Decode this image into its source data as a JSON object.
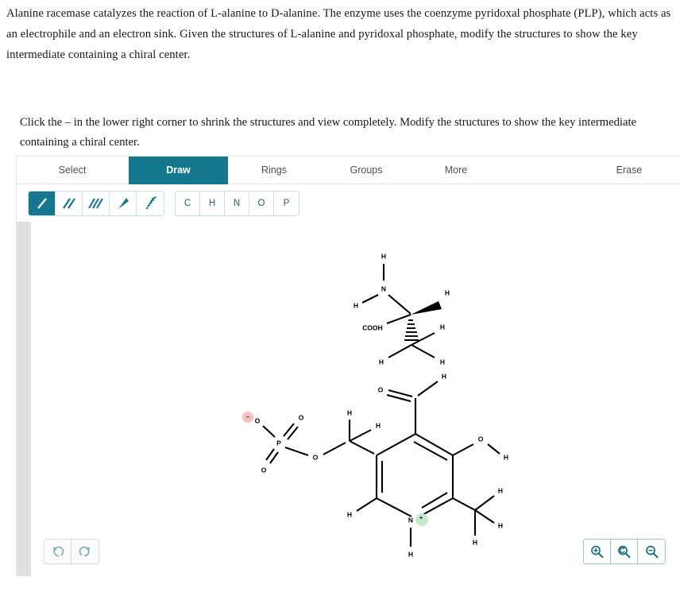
{
  "question": {
    "text": "Alanine racemase catalyzes the reaction of L-alanine to D-alanine. The enzyme uses the coenzyme pyridoxal phosphate (PLP), which acts as an electrophile and an electron sink. Given the structures of L-alanine and pyridoxal phosphate, modify the structures to show the key intermediate containing a chiral center."
  },
  "instruction": {
    "text": "Click the – in the lower right corner to shrink the structures and view completely. Modify the structures to show the key intermediate containing a chiral center."
  },
  "editor": {
    "tabs": [
      {
        "label": "Select",
        "active": false
      },
      {
        "label": "Draw",
        "active": true
      },
      {
        "label": "Rings",
        "active": false
      },
      {
        "label": "Groups",
        "active": false
      },
      {
        "label": "More",
        "active": false
      },
      {
        "label": "Erase",
        "active": false
      }
    ],
    "bond_tools": [
      {
        "name": "single-bond-tool",
        "icon": "single-bond-icon",
        "active": true
      },
      {
        "name": "double-bond-tool",
        "icon": "double-bond-icon",
        "active": false
      },
      {
        "name": "triple-bond-tool",
        "icon": "triple-bond-icon",
        "active": false
      },
      {
        "name": "wedge-bond-tool",
        "icon": "wedge-bond-icon",
        "active": false
      },
      {
        "name": "hash-bond-tool",
        "icon": "hash-bond-icon",
        "active": false
      }
    ],
    "element_tools": [
      {
        "label": "C",
        "name": "element-carbon"
      },
      {
        "label": "H",
        "name": "element-hydrogen"
      },
      {
        "label": "N",
        "name": "element-nitrogen"
      },
      {
        "label": "O",
        "name": "element-oxygen"
      },
      {
        "label": "P",
        "name": "element-phosphorus"
      }
    ],
    "history_tools": [
      {
        "name": "undo-button",
        "icon": "undo-arrow-icon"
      },
      {
        "name": "redo-button",
        "icon": "redo-arrow-icon"
      }
    ],
    "zoom_tools": [
      {
        "name": "zoom-in-button",
        "icon": "magnifier-plus-icon"
      },
      {
        "name": "zoom-reset-button",
        "icon": "magnifier-reset-icon"
      },
      {
        "name": "zoom-out-button",
        "icon": "magnifier-minus-icon"
      }
    ]
  },
  "colors": {
    "accent_teal": "#16788e",
    "tab_text": "#4c4f52",
    "negative_charge_highlight": "#f4c2c2",
    "positive_charge_highlight": "#c8e6c9",
    "canvas_gutter": "#e0e0e0",
    "scrollbar_thumb": "#b3b3b3"
  },
  "structures": [
    {
      "name": "l-alanine",
      "atom_labels": [
        "H",
        "N",
        "H",
        "COOH",
        "H",
        "H",
        "H",
        "H"
      ],
      "charges": []
    },
    {
      "name": "pyridoxal-phosphate",
      "atom_labels": [
        "O",
        "O",
        "O",
        "P",
        "O",
        "H",
        "H",
        "O",
        "H",
        "O",
        "H",
        "H",
        "H",
        "H",
        "N",
        "H",
        "H"
      ],
      "charges": [
        {
          "atom": "O",
          "sign": "–",
          "highlight": "#f4c2c2"
        },
        {
          "atom": "N",
          "sign": "+",
          "highlight": "#c8e6c9"
        }
      ]
    }
  ]
}
